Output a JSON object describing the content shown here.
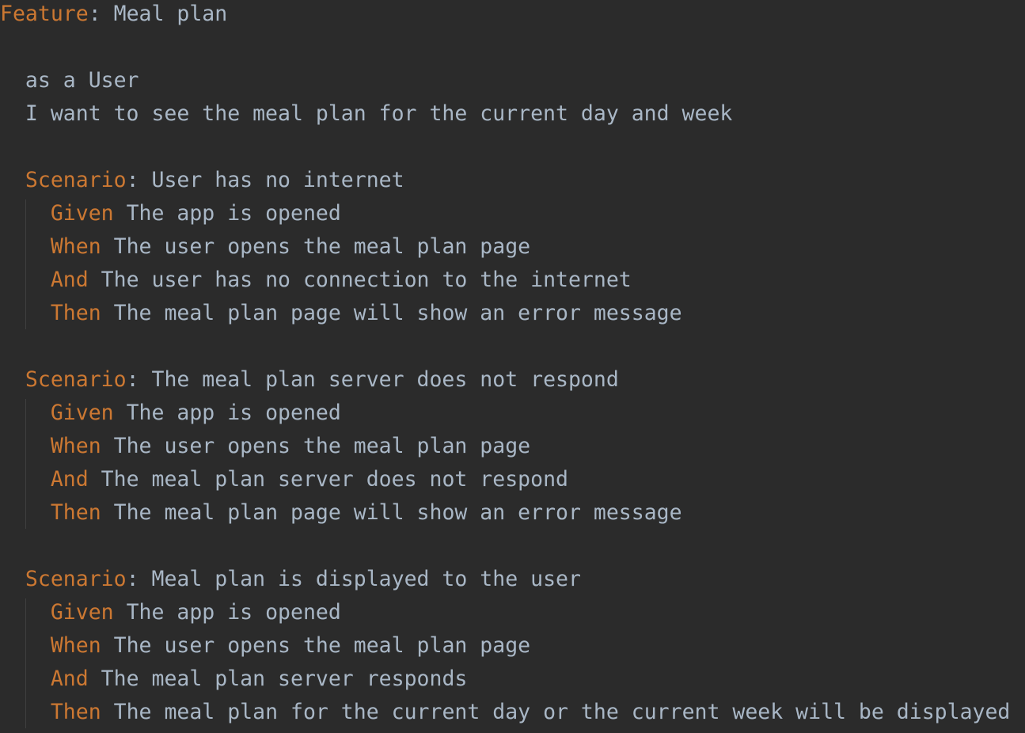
{
  "feature": {
    "keyword": "Feature",
    "title": "Meal plan",
    "narrative": [
      "as a User",
      "I want to see the meal plan for the current day and week"
    ]
  },
  "scenarios": [
    {
      "keyword": "Scenario",
      "title": "User has no internet",
      "steps": [
        {
          "keyword": "Given",
          "text": "The app is opened"
        },
        {
          "keyword": "When",
          "text": "The user opens the meal plan page"
        },
        {
          "keyword": "And",
          "text": "The user has no connection to the internet"
        },
        {
          "keyword": "Then",
          "text": "The meal plan page will show an error message"
        }
      ]
    },
    {
      "keyword": "Scenario",
      "title": "The meal plan server does not respond",
      "steps": [
        {
          "keyword": "Given",
          "text": "The app is opened"
        },
        {
          "keyword": "When",
          "text": "The user opens the meal plan page"
        },
        {
          "keyword": "And",
          "text": "The meal plan server does not respond"
        },
        {
          "keyword": "Then",
          "text": "The meal plan page will show an error message"
        }
      ]
    },
    {
      "keyword": "Scenario",
      "title": "Meal plan is displayed to the user",
      "steps": [
        {
          "keyword": "Given",
          "text": "The app is opened"
        },
        {
          "keyword": "When",
          "text": "The user opens the meal plan page"
        },
        {
          "keyword": "And",
          "text": "The meal plan server responds"
        },
        {
          "keyword": "Then",
          "text": "The meal plan for the current day or the current week will be displayed"
        }
      ]
    }
  ]
}
